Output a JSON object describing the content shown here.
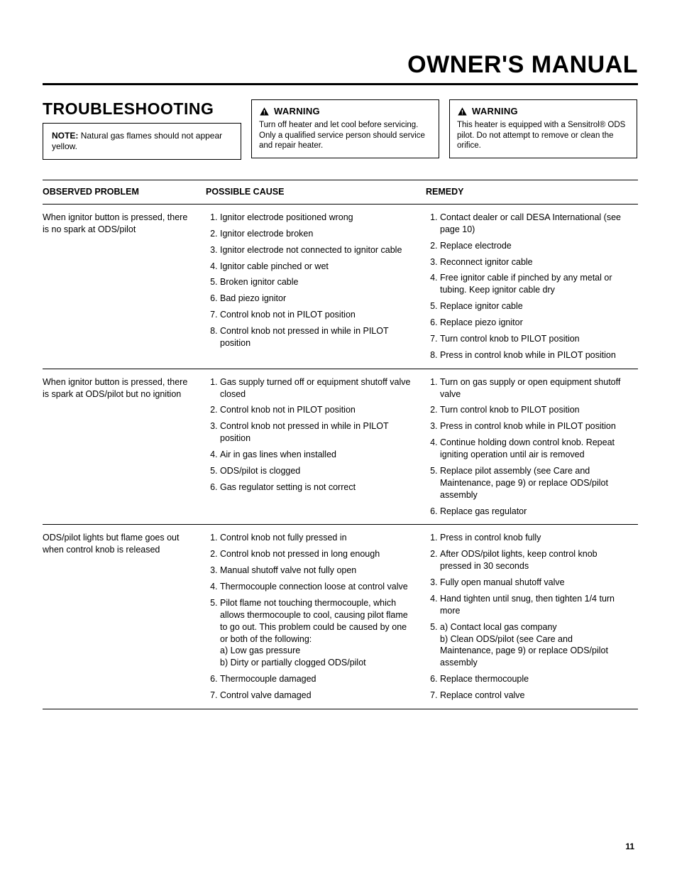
{
  "header": {
    "title": "OWNER'S MANUAL"
  },
  "section": {
    "heading": "TROUBLESHOOTING"
  },
  "note": {
    "text": "Natural gas flames should not appear yellow."
  },
  "warnings": [
    {
      "label": "WARNING",
      "body": "Turn off heater and let cool before servicing. Only a qualified service person should service and repair heater."
    },
    {
      "label": "WARNING",
      "body": "This heater is equipped with a Sensitrol® ODS pilot. Do not attempt to remove or clean the orifice."
    }
  ],
  "table": {
    "headers": {
      "observed": "OBSERVED PROBLEM",
      "cause": "POSSIBLE CAUSE",
      "remedy": "REMEDY"
    },
    "rows": [
      {
        "observed": "When ignitor button is pressed, there is no spark at ODS/pilot",
        "causes": [
          "Ignitor electrode positioned wrong",
          "Ignitor electrode broken",
          "Ignitor electrode not connected to ignitor cable",
          "Ignitor cable pinched or wet",
          "Broken ignitor cable",
          "Bad piezo ignitor",
          "Control knob not in PILOT position",
          "Control knob not pressed in while in PILOT position"
        ],
        "remedies": [
          "Contact dealer or call DESA International (see page 10)",
          "Replace electrode",
          "Reconnect ignitor cable",
          "Free ignitor cable if pinched by any metal or tubing. Keep ignitor cable dry",
          "Replace ignitor cable",
          "Replace piezo ignitor",
          "Turn control knob to PILOT position",
          "Press in control knob while in PILOT position"
        ]
      },
      {
        "observed": "When ignitor button is pressed, there is spark at ODS/pilot but no ignition",
        "causes": [
          "Gas supply turned off or equipment shutoff valve closed",
          "Control knob not in PILOT position",
          "Control knob not pressed in while in PILOT position",
          "Air in gas lines when installed",
          "ODS/pilot is clogged",
          "Gas regulator setting is not correct"
        ],
        "remedies": [
          "Turn on gas supply or open equipment shutoff valve",
          "Turn control knob to PILOT position",
          "Press in control knob while in PILOT position",
          "Continue holding down control knob. Repeat igniting operation until air is removed",
          "Replace pilot assembly (see Care and Maintenance, page 9) or replace ODS/pilot assembly",
          "Replace gas regulator"
        ]
      },
      {
        "observed": "ODS/pilot lights but flame goes out when control knob is released",
        "causes": [
          "Control knob not fully pressed in",
          "Control knob not pressed in long enough",
          "Manual shutoff valve not fully open",
          "Thermocouple connection loose at control valve",
          "Pilot flame not touching thermocouple, which allows thermocouple to cool, causing pilot flame to go out. This problem could be caused by one or both of the following:\na) Low gas pressure\nb) Dirty or partially clogged ODS/pilot",
          "Thermocouple damaged",
          "Control valve damaged"
        ],
        "remedies": [
          "Press in control knob fully",
          "After ODS/pilot lights, keep control knob pressed in 30 seconds",
          "Fully open manual shutoff valve",
          "Hand tighten until snug, then tighten 1/4 turn more",
          "a) Contact local gas company\nb) Clean ODS/pilot (see Care and Maintenance, page 9) or replace ODS/pilot assembly",
          "Replace thermocouple",
          "Replace control valve"
        ]
      }
    ]
  },
  "page_number": "11"
}
